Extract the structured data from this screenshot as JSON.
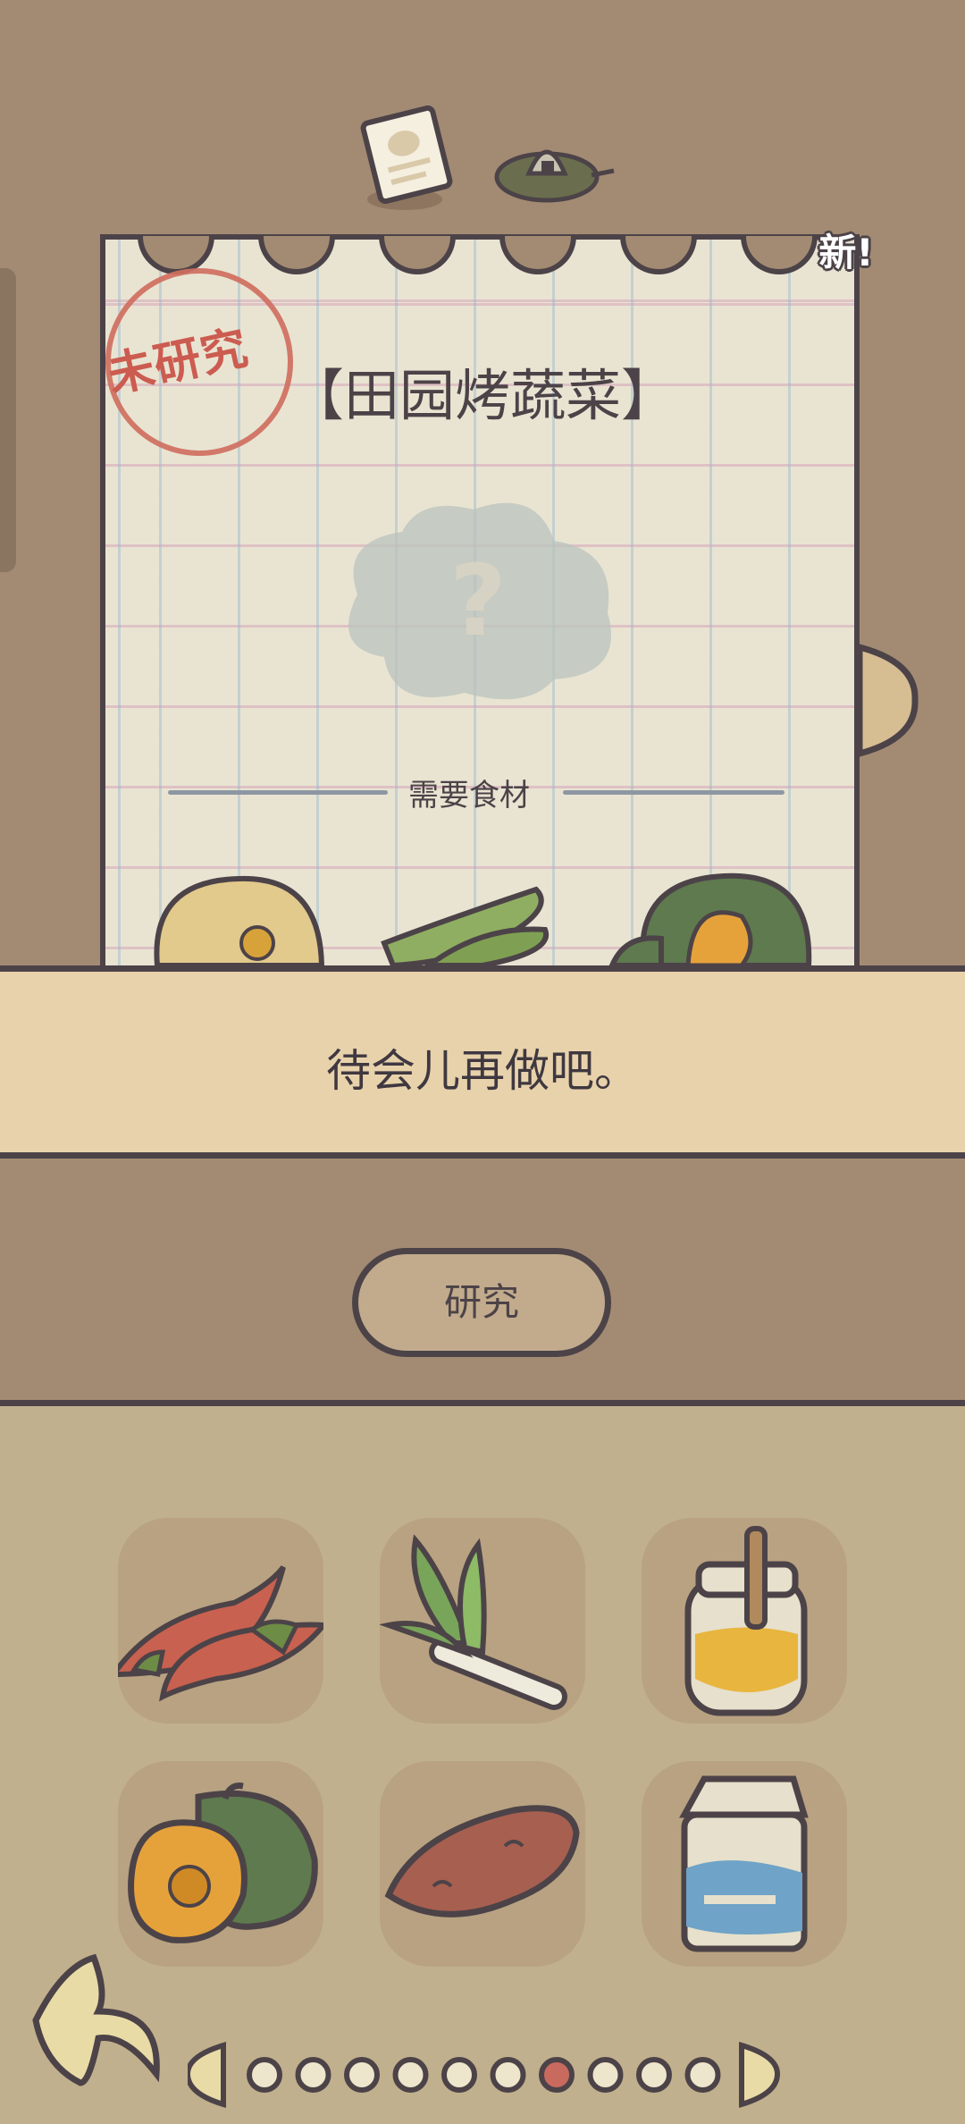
{
  "recipe": {
    "stamp": "未研究",
    "title": "【田园烤蔬菜】",
    "new_badge": "新!",
    "ingredients_label": "需要食材",
    "mystery_mark": "?"
  },
  "dialog": {
    "text": "待会儿再做吧。"
  },
  "actions": {
    "research_label": "研究"
  },
  "inventory": [
    {
      "name": "chili-pepper-icon"
    },
    {
      "name": "green-onion-icon"
    },
    {
      "name": "honey-jar-icon"
    },
    {
      "name": "pumpkin-icon"
    },
    {
      "name": "sweet-potato-icon"
    },
    {
      "name": "milk-carton-icon"
    }
  ],
  "pagination": {
    "total": 10,
    "current": 7
  },
  "colors": {
    "outline": "#4c4348",
    "background": "#a38b73",
    "paper": "#e9e4d2",
    "dialog": "#e8d2ab",
    "stamp": "#cc5c50",
    "inventory_bg": "#c1b08d",
    "active_page": "#c96a5e"
  }
}
